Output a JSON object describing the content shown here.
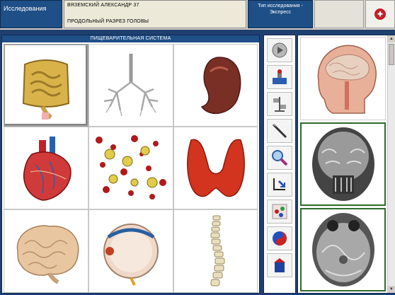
{
  "header": {
    "section_title": "Исследования",
    "patient_name": "ВЯЗЕМСКИЙ АЛЕКСАНДР 37",
    "organ_view": "ПРОДОЛЬНЫЙ РАЗРЕЗ ГОЛОВЫ",
    "exam_type_label": "Тип исследования -",
    "exam_type_value": "Экспресс"
  },
  "left_panel": {
    "title": "ПИЩЕВАРИТЕЛЬНАЯ СИСТЕМА",
    "organs": [
      {
        "icon": "intestines-icon",
        "selected": true
      },
      {
        "icon": "lungs-icon",
        "selected": false
      },
      {
        "icon": "kidney-icon",
        "selected": false
      },
      {
        "icon": "heart-icon",
        "selected": false
      },
      {
        "icon": "blood-cells-icon",
        "selected": false
      },
      {
        "icon": "thyroid-icon",
        "selected": false
      },
      {
        "icon": "brain-icon",
        "selected": false
      },
      {
        "icon": "eye-icon",
        "selected": false
      },
      {
        "icon": "spine-icon",
        "selected": false
      }
    ]
  },
  "toolbar": {
    "tools": [
      "disc-icon",
      "scanner-icon",
      "balance-icon",
      "probe-icon",
      "zoom-icon",
      "switch-icon",
      "chart-icon",
      "yin-yang-icon",
      "remedy-icon"
    ]
  },
  "right_panel": {
    "thumbnails": [
      "head-sagittal-icon",
      "head-coronal-mri-icon",
      "head-axial-mri-icon"
    ]
  },
  "colors": {
    "panel_header": "#1e4f86",
    "background": "#1f3f6e",
    "thumb_selected_border": "#2f6a2f"
  }
}
